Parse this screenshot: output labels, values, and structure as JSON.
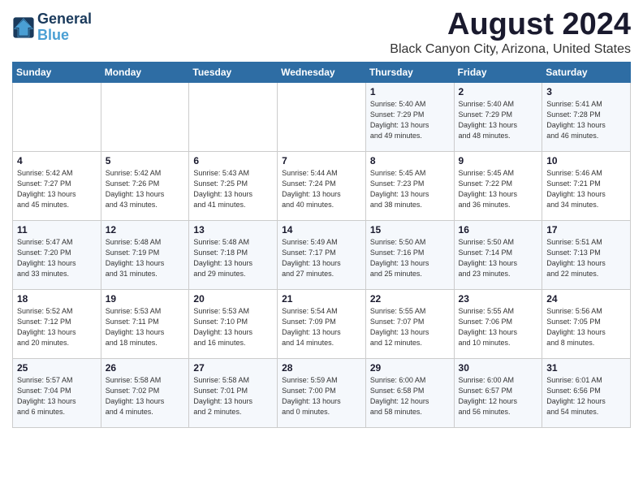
{
  "logo": {
    "line1": "General",
    "line2": "Blue"
  },
  "title": "August 2024",
  "subtitle": "Black Canyon City, Arizona, United States",
  "days_of_week": [
    "Sunday",
    "Monday",
    "Tuesday",
    "Wednesday",
    "Thursday",
    "Friday",
    "Saturday"
  ],
  "weeks": [
    [
      {
        "day": "",
        "info": ""
      },
      {
        "day": "",
        "info": ""
      },
      {
        "day": "",
        "info": ""
      },
      {
        "day": "",
        "info": ""
      },
      {
        "day": "1",
        "info": "Sunrise: 5:40 AM\nSunset: 7:29 PM\nDaylight: 13 hours\nand 49 minutes."
      },
      {
        "day": "2",
        "info": "Sunrise: 5:40 AM\nSunset: 7:29 PM\nDaylight: 13 hours\nand 48 minutes."
      },
      {
        "day": "3",
        "info": "Sunrise: 5:41 AM\nSunset: 7:28 PM\nDaylight: 13 hours\nand 46 minutes."
      }
    ],
    [
      {
        "day": "4",
        "info": "Sunrise: 5:42 AM\nSunset: 7:27 PM\nDaylight: 13 hours\nand 45 minutes."
      },
      {
        "day": "5",
        "info": "Sunrise: 5:42 AM\nSunset: 7:26 PM\nDaylight: 13 hours\nand 43 minutes."
      },
      {
        "day": "6",
        "info": "Sunrise: 5:43 AM\nSunset: 7:25 PM\nDaylight: 13 hours\nand 41 minutes."
      },
      {
        "day": "7",
        "info": "Sunrise: 5:44 AM\nSunset: 7:24 PM\nDaylight: 13 hours\nand 40 minutes."
      },
      {
        "day": "8",
        "info": "Sunrise: 5:45 AM\nSunset: 7:23 PM\nDaylight: 13 hours\nand 38 minutes."
      },
      {
        "day": "9",
        "info": "Sunrise: 5:45 AM\nSunset: 7:22 PM\nDaylight: 13 hours\nand 36 minutes."
      },
      {
        "day": "10",
        "info": "Sunrise: 5:46 AM\nSunset: 7:21 PM\nDaylight: 13 hours\nand 34 minutes."
      }
    ],
    [
      {
        "day": "11",
        "info": "Sunrise: 5:47 AM\nSunset: 7:20 PM\nDaylight: 13 hours\nand 33 minutes."
      },
      {
        "day": "12",
        "info": "Sunrise: 5:48 AM\nSunset: 7:19 PM\nDaylight: 13 hours\nand 31 minutes."
      },
      {
        "day": "13",
        "info": "Sunrise: 5:48 AM\nSunset: 7:18 PM\nDaylight: 13 hours\nand 29 minutes."
      },
      {
        "day": "14",
        "info": "Sunrise: 5:49 AM\nSunset: 7:17 PM\nDaylight: 13 hours\nand 27 minutes."
      },
      {
        "day": "15",
        "info": "Sunrise: 5:50 AM\nSunset: 7:16 PM\nDaylight: 13 hours\nand 25 minutes."
      },
      {
        "day": "16",
        "info": "Sunrise: 5:50 AM\nSunset: 7:14 PM\nDaylight: 13 hours\nand 23 minutes."
      },
      {
        "day": "17",
        "info": "Sunrise: 5:51 AM\nSunset: 7:13 PM\nDaylight: 13 hours\nand 22 minutes."
      }
    ],
    [
      {
        "day": "18",
        "info": "Sunrise: 5:52 AM\nSunset: 7:12 PM\nDaylight: 13 hours\nand 20 minutes."
      },
      {
        "day": "19",
        "info": "Sunrise: 5:53 AM\nSunset: 7:11 PM\nDaylight: 13 hours\nand 18 minutes."
      },
      {
        "day": "20",
        "info": "Sunrise: 5:53 AM\nSunset: 7:10 PM\nDaylight: 13 hours\nand 16 minutes."
      },
      {
        "day": "21",
        "info": "Sunrise: 5:54 AM\nSunset: 7:09 PM\nDaylight: 13 hours\nand 14 minutes."
      },
      {
        "day": "22",
        "info": "Sunrise: 5:55 AM\nSunset: 7:07 PM\nDaylight: 13 hours\nand 12 minutes."
      },
      {
        "day": "23",
        "info": "Sunrise: 5:55 AM\nSunset: 7:06 PM\nDaylight: 13 hours\nand 10 minutes."
      },
      {
        "day": "24",
        "info": "Sunrise: 5:56 AM\nSunset: 7:05 PM\nDaylight: 13 hours\nand 8 minutes."
      }
    ],
    [
      {
        "day": "25",
        "info": "Sunrise: 5:57 AM\nSunset: 7:04 PM\nDaylight: 13 hours\nand 6 minutes."
      },
      {
        "day": "26",
        "info": "Sunrise: 5:58 AM\nSunset: 7:02 PM\nDaylight: 13 hours\nand 4 minutes."
      },
      {
        "day": "27",
        "info": "Sunrise: 5:58 AM\nSunset: 7:01 PM\nDaylight: 13 hours\nand 2 minutes."
      },
      {
        "day": "28",
        "info": "Sunrise: 5:59 AM\nSunset: 7:00 PM\nDaylight: 13 hours\nand 0 minutes."
      },
      {
        "day": "29",
        "info": "Sunrise: 6:00 AM\nSunset: 6:58 PM\nDaylight: 12 hours\nand 58 minutes."
      },
      {
        "day": "30",
        "info": "Sunrise: 6:00 AM\nSunset: 6:57 PM\nDaylight: 12 hours\nand 56 minutes."
      },
      {
        "day": "31",
        "info": "Sunrise: 6:01 AM\nSunset: 6:56 PM\nDaylight: 12 hours\nand 54 minutes."
      }
    ]
  ]
}
